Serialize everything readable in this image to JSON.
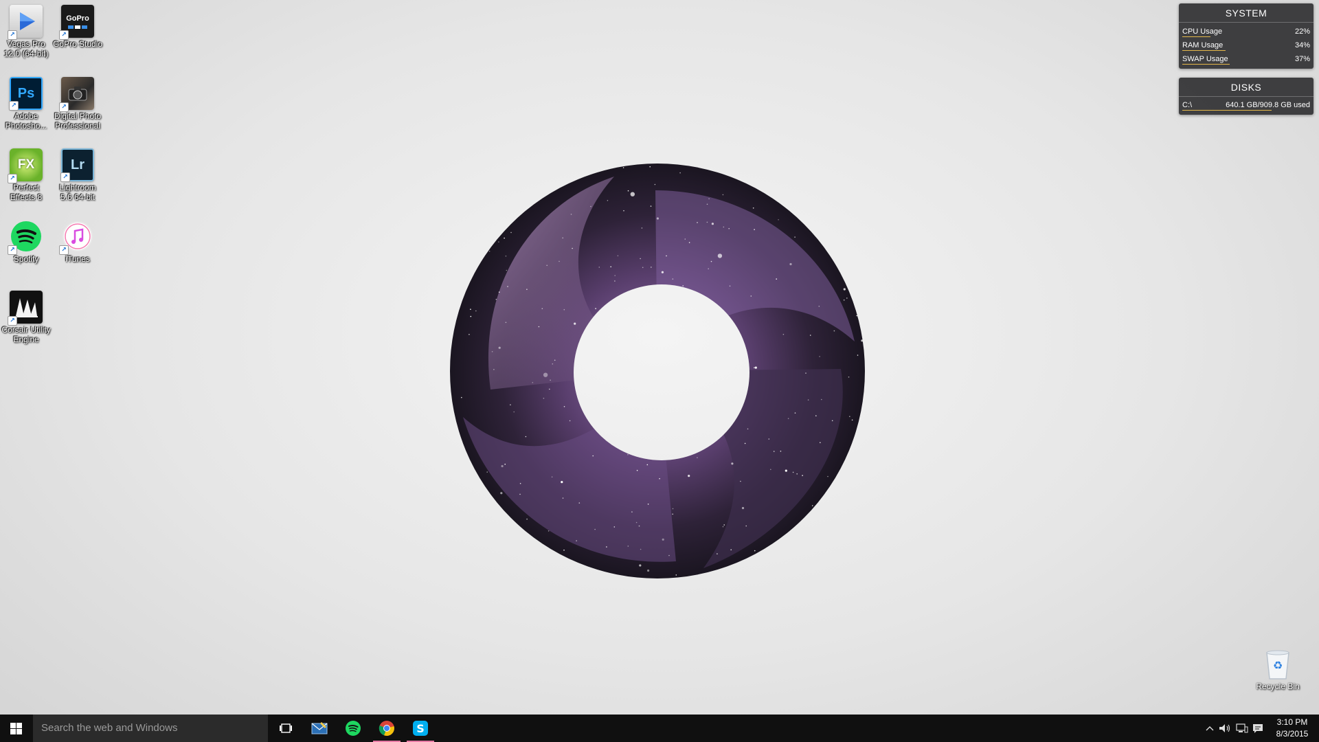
{
  "desktop": {
    "icons": [
      {
        "label": "Vegas Pro\n12.0 (64-bit)",
        "icon": "vegas-pro-icon"
      },
      {
        "label": "GoPro Studio",
        "icon": "gopro-icon",
        "badge": "GoPro"
      },
      {
        "label": "Adobe\nPhotosho...",
        "icon": "photoshop-icon",
        "badge": "Ps"
      },
      {
        "label": "Digital Photo\nProfessional",
        "icon": "digital-photo-icon"
      },
      {
        "label": "Perfect\nEffects 8",
        "icon": "perfect-effects-icon",
        "badge": "FX"
      },
      {
        "label": "Lightroom\n5.6 64-bit",
        "icon": "lightroom-icon",
        "badge": "Lr"
      },
      {
        "label": "Spotify",
        "icon": "spotify-icon"
      },
      {
        "label": "iTunes",
        "icon": "itunes-icon"
      },
      {
        "label": "Corsair Utility\nEngine",
        "icon": "corsair-icon"
      }
    ],
    "recycle_bin": {
      "label": "Recycle Bin",
      "icon": "recycle-bin-icon"
    }
  },
  "widgets": {
    "system": {
      "title": "SYSTEM",
      "rows": [
        {
          "label": "CPU Usage",
          "value": "22%",
          "fraction": 0.22
        },
        {
          "label": "RAM Usage",
          "value": "34%",
          "fraction": 0.34
        },
        {
          "label": "SWAP Usage",
          "value": "37%",
          "fraction": 0.37
        }
      ]
    },
    "disks": {
      "title": "DISKS",
      "rows": [
        {
          "label": "C:\\",
          "value": "640.1 GB/909.8 GB used",
          "fraction": 0.7
        }
      ]
    }
  },
  "taskbar": {
    "search_placeholder": "Search the web and Windows",
    "apps": [
      {
        "name": "task-view",
        "icon": "task-view-icon"
      },
      {
        "name": "mail",
        "icon": "mail-icon"
      },
      {
        "name": "spotify",
        "icon": "spotify-icon"
      },
      {
        "name": "chrome",
        "icon": "chrome-icon",
        "active": true
      },
      {
        "name": "skype",
        "icon": "skype-icon",
        "active": true
      }
    ],
    "tray": [
      "chevron-up-icon",
      "volume-icon",
      "network-icon",
      "action-center-icon"
    ],
    "time": "3:10 PM",
    "date": "8/3/2015"
  },
  "colors": {
    "taskbar_bg": "#101010",
    "search_bg": "#2b2b2b",
    "widget_bg": "#28282a",
    "bar_accent": "#e5b84a",
    "active_indicator": "#e77aa4",
    "ring_purple": "#7a5a92"
  }
}
